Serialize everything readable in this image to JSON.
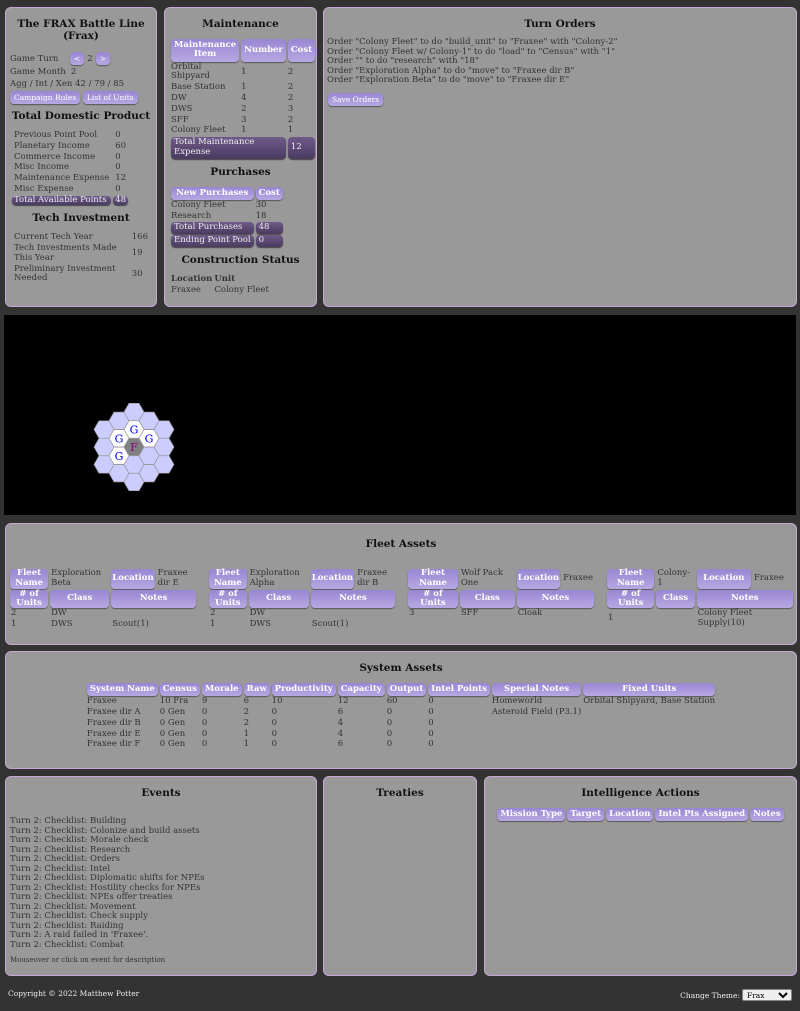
{
  "empire": {
    "title": "The FRAX Battle Line",
    "subtitle": "(Frax)",
    "game_turn_label": "Game Turn",
    "game_turn": "2",
    "prev": "<",
    "next": ">",
    "game_month_label": "Game Month",
    "game_month": "2",
    "agg_label": "Agg / Int / Xen",
    "agg_value": "42 / 79 / 85",
    "campaign_rules": "Campaign Rules",
    "list_of_units": "List of Units"
  },
  "tdp": {
    "title": "Total Domestic Product",
    "rows": [
      [
        "Previous Point Pool",
        "0"
      ],
      [
        "Planetary Income",
        "60"
      ],
      [
        "Commerce Income",
        "0"
      ],
      [
        "Misc Income",
        "0"
      ],
      [
        "Maintenance Expense",
        "12"
      ],
      [
        "Misc Expense",
        "0"
      ]
    ],
    "total_label": "Total Available Points",
    "total": "48"
  },
  "tech": {
    "title": "Tech Investment",
    "rows": [
      [
        "Current Tech Year",
        "166"
      ],
      [
        "Tech Investments Made This Year",
        "19"
      ],
      [
        "Preliminary Investment Needed",
        "30"
      ]
    ]
  },
  "maintenance": {
    "title": "Maintenance",
    "headers": [
      "Maintenance Item",
      "Number",
      "Cost"
    ],
    "rows": [
      [
        "Orbital Shipyard",
        "1",
        "2"
      ],
      [
        "Base Station",
        "1",
        "2"
      ],
      [
        "DW",
        "4",
        "2"
      ],
      [
        "DWS",
        "2",
        "3"
      ],
      [
        "SFF",
        "3",
        "2"
      ],
      [
        "Colony Fleet",
        "1",
        "1"
      ]
    ],
    "total_label": "Total Maintenance Expense",
    "total": "12"
  },
  "purchases": {
    "title": "Purchases",
    "headers": [
      "New Purchases",
      "Cost"
    ],
    "rows": [
      [
        "Colony Fleet",
        "30"
      ],
      [
        "Research",
        "18"
      ]
    ],
    "total_label": "Total Purchases",
    "total": "48",
    "ending_label": "Ending Point Pool",
    "ending": "0"
  },
  "construction": {
    "title": "Construction Status",
    "headers": [
      "Location",
      "Unit"
    ],
    "rows": [
      [
        "Fraxee",
        "Colony Fleet"
      ]
    ]
  },
  "orders": {
    "title": "Turn Orders",
    "lines": [
      "Order \"Colony Fleet\" to do \"build_unit\" to \"Fraxee\" with \"Colony-2\"",
      "Order \"Colony Fleet w/ Colony-1\" to do \"load\" to \"Census\" with \"1\"",
      "Order \"\" to do \"research\" with \"18\"",
      "Order \"Exploration Alpha\" to do \"move\" to \"Fraxee dir B\"",
      "Order \"Exploration Beta\" to do \"move\" to \"Fraxee dir E\""
    ],
    "save": "Save Orders"
  },
  "map": {
    "home_label": "F",
    "colony_label": "G",
    "home_color": "#800080",
    "colony_color": "#0000ff",
    "hex_color": "#ccccff"
  },
  "fleets": {
    "title": "Fleet Assets",
    "labels": {
      "name": "Fleet Name",
      "location": "Location",
      "units": "# of Units",
      "class": "Class",
      "notes": "Notes"
    },
    "items": [
      {
        "name": "Exploration Beta",
        "location": "Fraxee dir E",
        "rows": [
          [
            "2",
            "DW",
            ""
          ],
          [
            "1",
            "DWS",
            "Scout(1)"
          ]
        ]
      },
      {
        "name": "Exploration Alpha",
        "location": "Fraxee dir B",
        "rows": [
          [
            "2",
            "DW",
            ""
          ],
          [
            "1",
            "DWS",
            "Scout(1)"
          ]
        ]
      },
      {
        "name": "Wolf Pack One",
        "location": "Fraxee",
        "rows": [
          [
            "3",
            "SFF",
            "Cloak"
          ]
        ]
      },
      {
        "name": "Colony-1",
        "location": "Fraxee",
        "rows": [
          [
            "1",
            "",
            "Colony Fleet Supply(10)"
          ]
        ]
      }
    ]
  },
  "systems": {
    "title": "System Assets",
    "headers": [
      "System Name",
      "Census",
      "Morale",
      "Raw",
      "Productivity",
      "Capacity",
      "Output",
      "Intel Points",
      "Special Notes",
      "Fixed Units"
    ],
    "rows": [
      [
        "Fraxee",
        "10 Fra",
        "9",
        "6",
        "10",
        "12",
        "60",
        "0",
        "Homeworld",
        "Orbital Shipyard, Base Station"
      ],
      [
        "Fraxee dir A",
        "0 Gen",
        "0",
        "2",
        "0",
        "6",
        "0",
        "0",
        "Asteroid Field (P3.1)",
        ""
      ],
      [
        "Fraxee dir B",
        "0 Gen",
        "0",
        "2",
        "0",
        "4",
        "0",
        "0",
        "",
        ""
      ],
      [
        "Fraxee dir E",
        "0 Gen",
        "0",
        "1",
        "0",
        "4",
        "0",
        "0",
        "",
        ""
      ],
      [
        "Fraxee dir F",
        "0 Gen",
        "0",
        "1",
        "0",
        "6",
        "0",
        "0",
        "",
        ""
      ]
    ]
  },
  "events": {
    "title": "Events",
    "items": [
      "Turn 2: Checklist: Building",
      "Turn 2: Checklist: Colonize and build assets",
      "Turn 2: Checklist: Morale check",
      "Turn 2: Checklist: Research",
      "Turn 2: Checklist: Orders",
      "Turn 2: Checklist: Intel",
      "Turn 2: Checklist: Diplomatic shifts for NPEs",
      "Turn 2: Checklist: Hostility checks for NPEs",
      "Turn 2: Checklist: NPEs offer treaties",
      "Turn 2: Checklist: Movement",
      "Turn 2: Checklist: Check supply",
      "Turn 2: Checklist: Raiding",
      "Turn 2: A raid failed in 'Fraxee'.",
      "Turn 2: Checklist: Combat"
    ],
    "hint": "Mouseover or click on event for description"
  },
  "treaties": {
    "title": "Treaties"
  },
  "intel": {
    "title": "Intelligence Actions",
    "headers": [
      "Mission Type",
      "Target",
      "Location",
      "Intel Pts Assigned",
      "Notes"
    ]
  },
  "footer": {
    "copyright": "Copyright © 2022 Matthew Potter",
    "theme_label": "Change Theme:",
    "theme_value": "Frax"
  }
}
